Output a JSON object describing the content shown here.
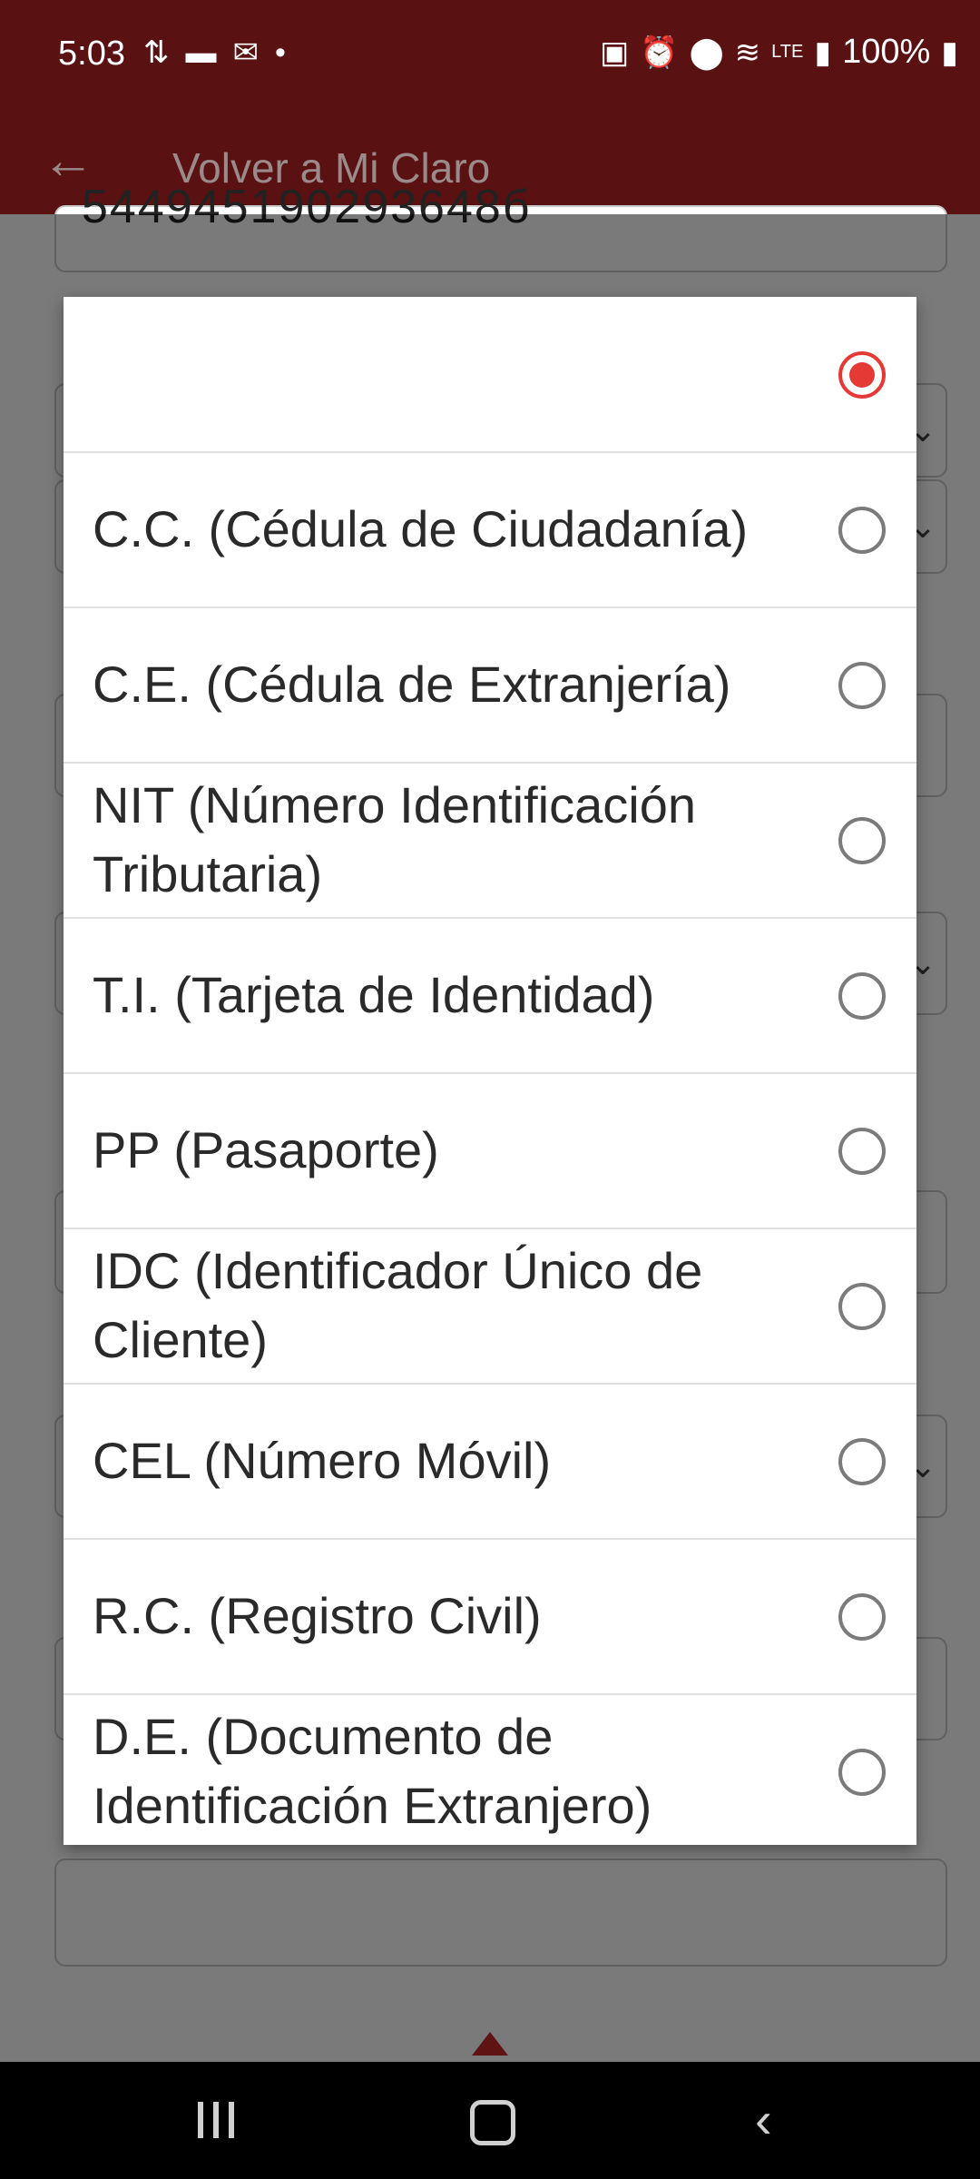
{
  "status_bar": {
    "time": "5:03",
    "left_icons": [
      "transfer-icon",
      "message-icon",
      "mail-icon",
      "dot-icon"
    ],
    "right_icons": [
      "battery-saver-icon",
      "alarm-icon",
      "location-icon",
      "wifi-icon",
      "volte-icon",
      "signal-icon"
    ],
    "battery": "100%"
  },
  "app_bar": {
    "title": "Volver a Mi Claro"
  },
  "form": {
    "top_field_value": "544945190293648б"
  },
  "dialog": {
    "options": [
      {
        "label": "",
        "selected": true
      },
      {
        "label": "C.C. (Cédula de Ciudadanía)",
        "selected": false
      },
      {
        "label": "C.E. (Cédula de Extranjería)",
        "selected": false
      },
      {
        "label": "NIT (Número Identificación Tributaria)",
        "selected": false
      },
      {
        "label": "T.I. (Tarjeta de Identidad)",
        "selected": false
      },
      {
        "label": "PP (Pasaporte)",
        "selected": false
      },
      {
        "label": "IDC (Identificador Único de Cliente)",
        "selected": false
      },
      {
        "label": "CEL (Número Móvil)",
        "selected": false
      },
      {
        "label": "R.C. (Registro Civil)",
        "selected": false
      },
      {
        "label": "D.E. (Documento de Identificación Extranjero)",
        "selected": false
      }
    ]
  },
  "colors": {
    "app_bar": "#5a1111",
    "radio_selected": "#e53935",
    "radio_unselected": "#7b7b7b"
  }
}
